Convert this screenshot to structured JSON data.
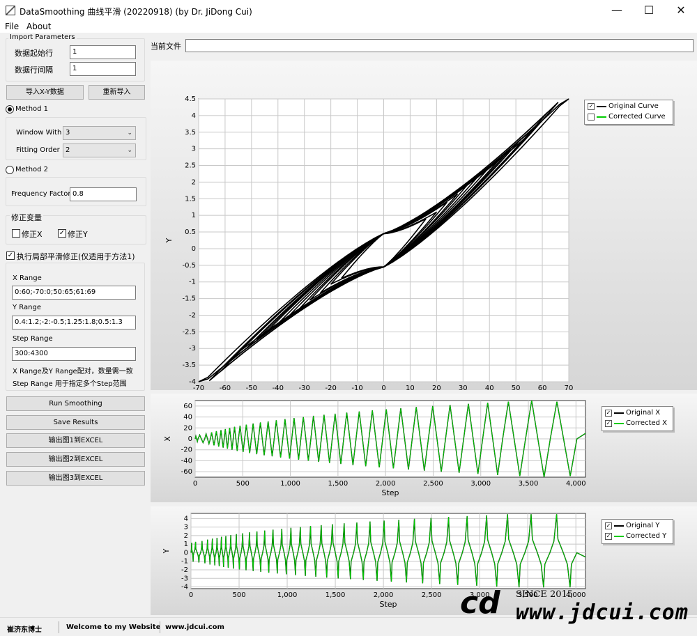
{
  "window": {
    "title": "DataSmoothing 曲线平滑 (20220918) (by Dr. JiDong Cui)",
    "minimize": "—",
    "maximize": "☐",
    "close": "✕"
  },
  "menu": {
    "file": "File",
    "about": "About"
  },
  "import_params": {
    "title": "Import Parameters",
    "start_row_label": "数据起始行",
    "start_row_value": "1",
    "row_interval_label": "数据行间隔",
    "row_interval_value": "1"
  },
  "buttons": {
    "import_xy": "导入X-Y数据",
    "reimport": "重新导入",
    "run": "Run Smoothing",
    "save": "Save Results",
    "export1": "输出图1到EXCEL",
    "export2": "输出图2到EXCEL",
    "export3": "输出图3到EXCEL"
  },
  "method1": {
    "label": "Method 1",
    "window_label": "Window With",
    "window_value": "3",
    "order_label": "Fitting Order",
    "order_value": "2"
  },
  "method2": {
    "label": "Method 2",
    "freq_label": "Frequency Factor",
    "freq_value": "0.8"
  },
  "correct_vars": {
    "title": "修正变量",
    "x_label": "修正X",
    "y_label": "修正Y",
    "x_checked": false,
    "y_checked": true
  },
  "local_smooth": {
    "label": "执行局部平滑修正(仅适用于方法1)",
    "checked": true,
    "x_range_label": "X Range",
    "x_range_value": "0:60;-70:0;50:65;61:69",
    "y_range_label": "Y Range",
    "y_range_value": "0.4:1.2;-2:-0.5;1.25:1.8;0.5:1.3",
    "step_range_label": "Step Range",
    "step_range_value": "300:4300",
    "note1": "X Range及Y Range配对，数量需一致",
    "note2": "Step Range 用于指定多个Step范围"
  },
  "current_file": {
    "label": "当前文件",
    "value": ""
  },
  "charts": {
    "chart1": {
      "xlabel": "X",
      "ylabel": "Y",
      "xticks": [
        "-70",
        "-60",
        "-50",
        "-40",
        "-30",
        "-20",
        "-10",
        "0",
        "10",
        "20",
        "30",
        "40",
        "50",
        "60",
        "70"
      ],
      "yticks": [
        "4.5",
        "4",
        "3.5",
        "3",
        "2.5",
        "2",
        "1.5",
        "1",
        "0.5",
        "0",
        "-0.5",
        "-1",
        "-1.5",
        "-2",
        "-2.5",
        "-3",
        "-3.5",
        "-4"
      ],
      "legend": [
        {
          "label": "Original Curve",
          "checked": true
        },
        {
          "label": "Corrected Curve",
          "checked": false
        }
      ]
    },
    "chart2": {
      "xlabel": "Step",
      "ylabel": "X",
      "xticks": [
        "0",
        "500",
        "1,000",
        "1,500",
        "2,000",
        "2,500",
        "3,000",
        "3,500",
        "4,000"
      ],
      "yticks": [
        "60",
        "40",
        "20",
        "0",
        "-20",
        "-40",
        "-60"
      ],
      "legend": [
        {
          "label": "Original X",
          "checked": true
        },
        {
          "label": "Corrected X",
          "checked": true
        }
      ]
    },
    "chart3": {
      "xlabel": "Step",
      "ylabel": "Y",
      "xticks": [
        "0",
        "500",
        "1,000",
        "1,500",
        "2,000",
        "2,500",
        "3,000",
        "3,500",
        "4,000"
      ],
      "yticks": [
        "4",
        "3",
        "2",
        "1",
        "0",
        "-1",
        "-2",
        "-3",
        "-4"
      ],
      "legend": [
        {
          "label": "Original Y",
          "checked": true
        },
        {
          "label": "Corrected Y",
          "checked": true
        }
      ]
    }
  },
  "colors": {
    "original": "#000000",
    "corrected": "#00cc00"
  },
  "status": {
    "author": "崔济东博士",
    "welcome": "Welcome to my Website",
    "site": "www.jdcui.com"
  },
  "watermark": {
    "logo": "cd",
    "since": "SINCE 2015",
    "url": "www.jdcui.com"
  },
  "chart_data": [
    {
      "type": "line",
      "description_free": true,
      "xlabel": "X",
      "ylabel": "Y",
      "xlim": [
        -70,
        70
      ],
      "ylim": [
        -4,
        4.5
      ],
      "grid": true,
      "legend_position": "right",
      "series": [
        {
          "name": "Original Curve",
          "cycles": [
            [
              16,
              0.9
            ],
            [
              20,
              1.1
            ],
            [
              24,
              1.4
            ],
            [
              28,
              1.65
            ],
            [
              32,
              1.95
            ],
            [
              36,
              2.2
            ],
            [
              40,
              2.45
            ],
            [
              44,
              2.7
            ],
            [
              48,
              3.0
            ],
            [
              52,
              3.3
            ],
            [
              56,
              3.5
            ],
            [
              59,
              3.8
            ],
            [
              62,
              4.1
            ],
            [
              66,
              4.4
            ],
            [
              70,
              4.6
            ]
          ]
        },
        {
          "name": "Corrected Curve",
          "cycles": []
        }
      ]
    },
    {
      "type": "line",
      "xlabel": "Step",
      "ylabel": "X",
      "xlim": [
        0,
        4100
      ],
      "ylim": [
        -70,
        70
      ],
      "legend_position": "right",
      "peaks": [
        [
          30,
          5
        ],
        [
          100,
          7
        ],
        [
          160,
          9
        ],
        [
          210,
          12
        ],
        [
          260,
          14
        ],
        [
          305,
          16
        ],
        [
          350,
          18
        ],
        [
          400,
          20
        ],
        [
          455,
          22
        ],
        [
          520,
          24
        ],
        [
          590,
          26
        ],
        [
          665,
          28
        ],
        [
          745,
          30
        ],
        [
          830,
          32
        ],
        [
          920,
          34
        ],
        [
          1015,
          36
        ],
        [
          1110,
          38
        ],
        [
          1215,
          40
        ],
        [
          1325,
          42
        ],
        [
          1440,
          44
        ],
        [
          1560,
          46
        ],
        [
          1690,
          48
        ],
        [
          1825,
          50
        ],
        [
          1970,
          52
        ],
        [
          2120,
          54
        ],
        [
          2280,
          56
        ],
        [
          2450,
          58
        ],
        [
          2630,
          60
        ],
        [
          2820,
          62
        ],
        [
          3020,
          64
        ],
        [
          3230,
          66
        ],
        [
          3470,
          68
        ],
        [
          3730,
          70
        ],
        [
          4010,
          68
        ]
      ],
      "series": [
        {
          "name": "Original X"
        },
        {
          "name": "Corrected X"
        }
      ]
    },
    {
      "type": "line",
      "xlabel": "Step",
      "ylabel": "Y",
      "xlim": [
        0,
        4100
      ],
      "ylim": [
        -4,
        4.5
      ],
      "legend_position": "right",
      "series": [
        {
          "name": "Original Y"
        },
        {
          "name": "Corrected Y"
        }
      ]
    }
  ]
}
